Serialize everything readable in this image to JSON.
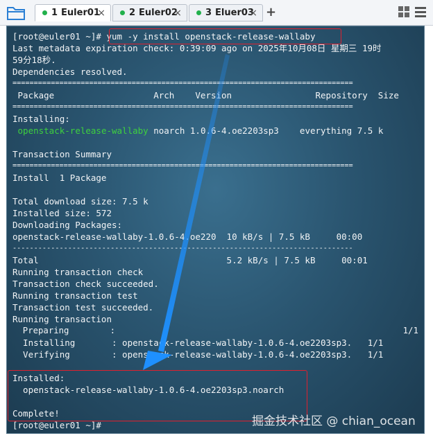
{
  "tabs": [
    {
      "num": "1",
      "label": "Euler01",
      "close": "×"
    },
    {
      "num": "2",
      "label": "Euler02",
      "close": "×"
    },
    {
      "num": "3",
      "label": "Eluer03",
      "close": "×"
    }
  ],
  "add_tab": "+",
  "terminal": {
    "lines": [
      "[root@euler01 ~]# yum -y install openstack-release-wallaby",
      "Last metadata expiration check: 0:39:09 ago on 2025年10月08日 星期三 19时",
      "59分18秒.",
      "Dependencies resolved.",
      "================================================================================",
      " Package                   Arch    Version                Repository  Size",
      "================================================================================",
      "Installing:",
      " openstack-release-wallaby noarch 1.0.6-4.oe2203sp3    everything 7.5 k",
      "",
      "Transaction Summary",
      "================================================================================",
      "Install  1 Package",
      "",
      "Total download size: 7.5 k",
      "Installed size: 572",
      "Downloading Packages:",
      "openstack-release-wallaby-1.0.6-4.oe220  10 kB/s | 7.5 kB     00:00",
      "--------------------------------------------------------------------------------",
      "Total                                    5.2 kB/s | 7.5 kB     00:01",
      "Running transaction check",
      "Transaction check succeeded.",
      "Running transaction test",
      "Transaction test succeeded.",
      "Running transaction",
      "  Preparing        :                                                        1/1",
      "  Installing       : openstack-release-wallaby-1.0.6-4.oe2203sp3.   1/1",
      "  Verifying        : openstack-release-wallaby-1.0.6-4.oe2203sp3.   1/1",
      "",
      "Installed:",
      "  openstack-release-wallaby-1.0.6-4.oe2203sp3.noarch",
      "",
      "Complete!",
      "[root@euler01 ~]#"
    ],
    "pkg_prefix": " ",
    "pkg_name": "openstack-release-wallaby",
    "pkg_rest": " noarch 1.0.6-4.oe2203sp3    everything 7.5 k"
  },
  "watermark": {
    "cn": "掘金技术社区",
    "at": " @ chian_ocean"
  },
  "colors": {
    "terminal_bg": "#2a5570",
    "text": "#f2f4f6",
    "package_green": "#3ed13e",
    "highlight_red": "#e0202e",
    "arrow_blue": "#1e90ff",
    "status_dot": "#22b14c"
  }
}
